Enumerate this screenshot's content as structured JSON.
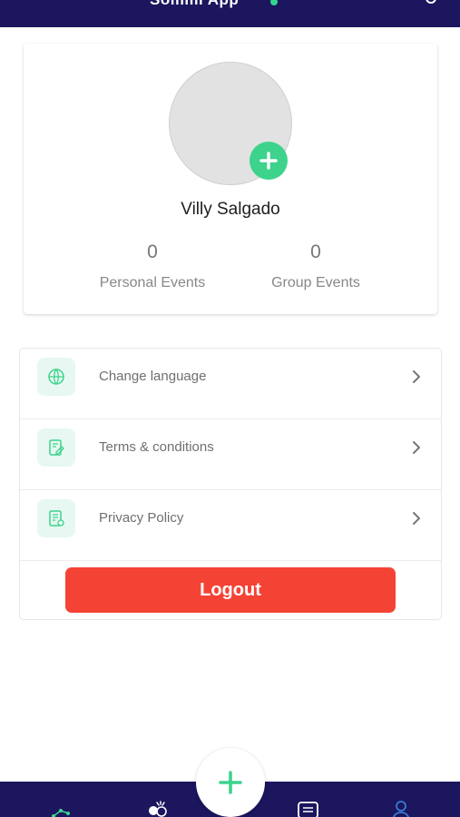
{
  "header": {
    "title": "Sommi App"
  },
  "profile": {
    "name": "Villy Salgado",
    "stats": {
      "personal_count": "0",
      "personal_label": "Personal Events",
      "group_count": "0",
      "group_label": "Group Events"
    }
  },
  "menu": {
    "items": [
      {
        "label": "Change language",
        "icon": "globe-icon"
      },
      {
        "label": "Terms & conditions",
        "icon": "document-edit-icon"
      },
      {
        "label": "Privacy Policy",
        "icon": "policy-document-icon"
      }
    ],
    "logout_label": "Logout"
  },
  "bottom_nav": {
    "items": [
      "stats-icon",
      "group-icon",
      "chat-icon",
      "profile-icon"
    ],
    "center_action": "add-icon"
  },
  "colors": {
    "nav_background": "#1b165e",
    "accent_green": "#3dd38d",
    "logout_red": "#f44335",
    "active_nav": "#3a7bd5"
  }
}
